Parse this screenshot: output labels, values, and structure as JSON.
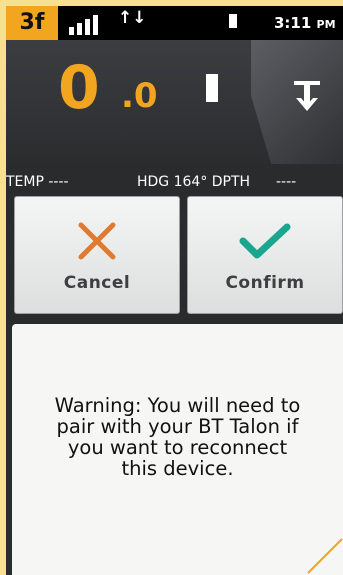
{
  "status_bar": {
    "badge": "3f",
    "data_arrows": "↑↓",
    "time": "3:11",
    "ampm": "PM"
  },
  "readout": {
    "speed_integer": "0",
    "speed_decimal": ".0"
  },
  "data_strip": {
    "temp": "TEMP ----",
    "heading": "HDG 164° DPTH",
    "depth": "----"
  },
  "buttons": {
    "cancel_label": "Cancel",
    "confirm_label": "Confirm"
  },
  "message": {
    "lines": [
      "Warning: You will need to",
      "pair with your BT Talon if",
      "you want to reconnect",
      "this device."
    ]
  },
  "colors": {
    "accent_orange": "#f2a51f",
    "cancel_x": "#e07a2f",
    "confirm_check": "#1aa58e",
    "frame": "#f8e08f"
  },
  "icons": [
    "signal-strength-icon",
    "data-transfer-icon",
    "battery-icon",
    "down-arrow-icon",
    "cancel-x-icon",
    "confirm-check-icon"
  ]
}
